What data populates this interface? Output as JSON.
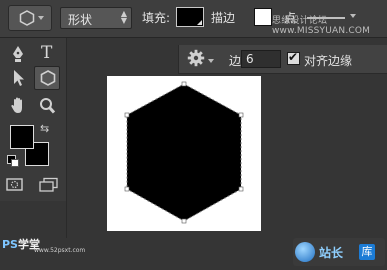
{
  "options_bar": {
    "tool_icon": "polygon-icon",
    "mode_value": "形状",
    "fill_label": "填充:",
    "fill_color": "#000000",
    "stroke_label": "描边",
    "stroke_color": "#ffffff",
    "stroke_size": "点",
    "watermark": "思缘设计论坛 www.MISSYUAN.COM"
  },
  "tool_panel": {
    "tools": [
      {
        "name": "pen-tool",
        "icon": "pen-icon"
      },
      {
        "name": "type-tool",
        "icon": "type-icon",
        "glyph": "T"
      },
      {
        "name": "path-select-tool",
        "icon": "arrow-icon"
      },
      {
        "name": "polygon-tool",
        "icon": "polygon-icon",
        "active": true
      },
      {
        "name": "hand-tool",
        "icon": "hand-icon"
      },
      {
        "name": "zoom-tool",
        "icon": "magnifier-icon"
      }
    ],
    "foreground_color": "#000000",
    "background_color": "#000000",
    "swap_glyph": "⇆"
  },
  "sides_popup": {
    "gear_icon": "gear-icon",
    "sides_label": "边:",
    "sides_value": "6",
    "align_edges_checked": true,
    "align_edges_label": "对齐边缘"
  },
  "canvas": {
    "background": "#ffffff",
    "shape": "hexagon",
    "shape_fill": "#000000"
  },
  "footer": {
    "ps_logo_prefix": "PS",
    "ps_logo_suffix": "学堂",
    "site_url": "www.52psxt.com",
    "site_logo_name": "站长",
    "site_logo_badge": "库"
  }
}
